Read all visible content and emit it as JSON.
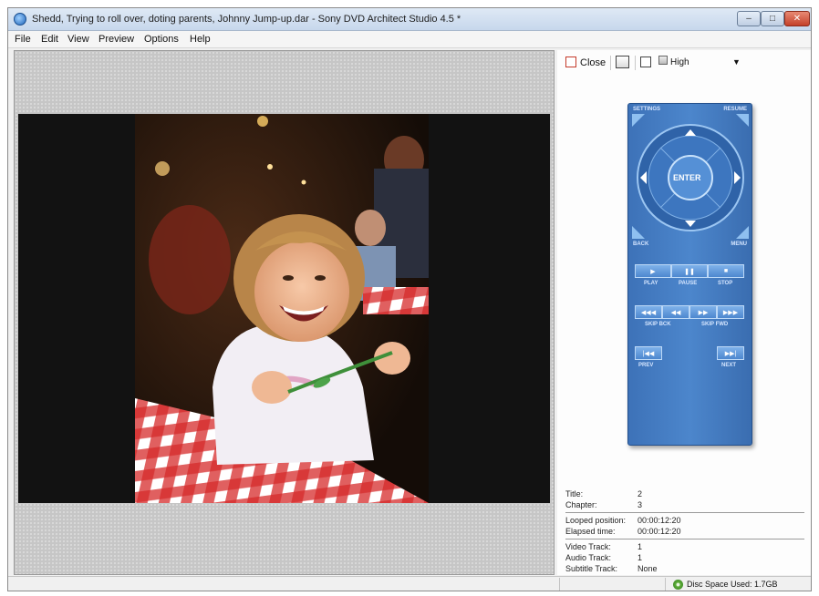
{
  "window": {
    "title": "Shedd, Trying to roll over, doting parents, Johnny Jump-up.dar - Sony DVD Architect Studio 4.5 *",
    "controls": {
      "minimize": "–",
      "maximize": "□",
      "close": "✕"
    }
  },
  "menu": [
    "File",
    "Edit",
    "View",
    "Preview",
    "Options",
    "Help"
  ],
  "preview_toolbar": {
    "close_label": "Close",
    "quality_value": "High"
  },
  "remote": {
    "settings": "SETTINGS",
    "resume": "RESUME",
    "enter": "ENTER",
    "back": "BACK",
    "menu": "MENU",
    "play": "PLAY",
    "pause": "PAUSE",
    "stop": "STOP",
    "skip_back": "SKIP BCK",
    "skip_fwd": "SKIP FWD",
    "prev": "PREV",
    "next": "NEXT"
  },
  "info": {
    "title_label": "Title:",
    "title_value": "2",
    "chapter_label": "Chapter:",
    "chapter_value": "3",
    "looped_label": "Looped position:",
    "looped_value": "00:00:12:20",
    "elapsed_label": "Elapsed time:",
    "elapsed_value": "00:00:12:20",
    "video_label": "Video Track:",
    "video_value": "1",
    "audio_label": "Audio Track:",
    "audio_value": "1",
    "subtitle_label": "Subtitle Track:",
    "subtitle_value": "None"
  },
  "status": {
    "disc_space": "Disc Space Used: 1.7GB"
  },
  "icons": [
    "app-icon",
    "close-icon",
    "safe-area-icon",
    "fullscreen-icon",
    "quality-icon",
    "dropdown-arrow-icon",
    "disc-icon"
  ]
}
